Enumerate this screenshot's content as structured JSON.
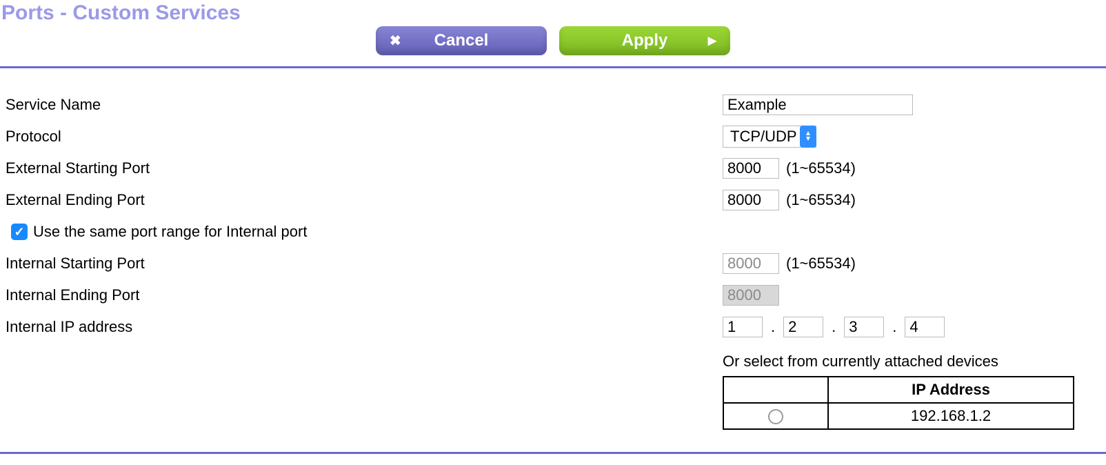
{
  "title": "Ports - Custom Services",
  "buttons": {
    "cancel": "Cancel",
    "apply": "Apply"
  },
  "labels": {
    "service_name": "Service Name",
    "protocol": "Protocol",
    "ext_start": "External Starting Port",
    "ext_end": "External Ending Port",
    "same_range": "Use the same port range for Internal port",
    "int_start": "Internal Starting Port",
    "int_end": "Internal Ending Port",
    "int_ip": "Internal IP address",
    "or_select": "Or select from currently attached devices",
    "ip_address_header": "IP Address"
  },
  "values": {
    "service_name": "Example",
    "protocol": "TCP/UDP",
    "ext_start": "8000",
    "ext_end": "8000",
    "int_start": "8000",
    "int_end": "8000",
    "ip": {
      "a": "1",
      "b": "2",
      "c": "3",
      "d": "4"
    }
  },
  "hints": {
    "port_range": "(1~65534)"
  },
  "devices": [
    {
      "ip": "192.168.1.2"
    }
  ]
}
